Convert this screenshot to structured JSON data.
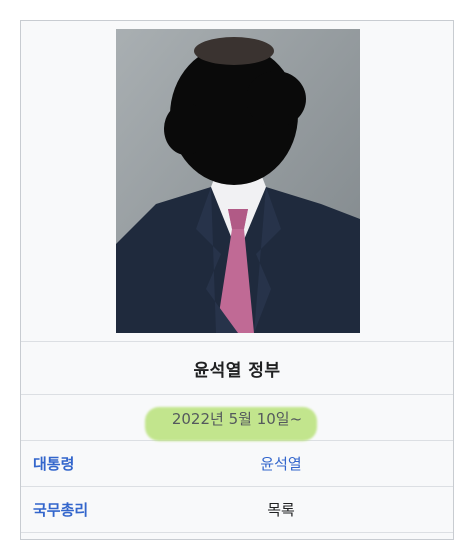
{
  "infobox": {
    "title": "윤석열 정부",
    "date_range": "2022년 5월 10일~",
    "rows": [
      {
        "label": "대통령",
        "value": "윤석열"
      },
      {
        "label": "국무총리",
        "value": "목록"
      }
    ]
  },
  "colors": {
    "link": "#3366cc",
    "highlight": "#b9e27a",
    "background": "#f8f9fa",
    "border": "#c8ccd1"
  }
}
